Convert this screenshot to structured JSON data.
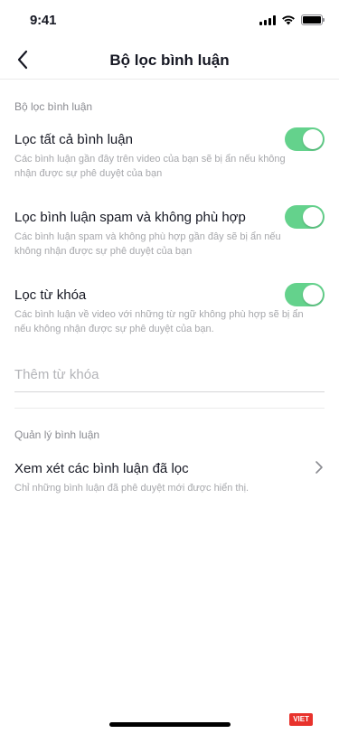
{
  "status_bar": {
    "time": "9:41"
  },
  "header": {
    "title": "Bộ lọc bình luận"
  },
  "section_filter": {
    "title": "Bộ lọc bình luận",
    "items": [
      {
        "label": "Lọc tất cả bình luận",
        "description": "Các bình luận gần đây trên video của bạn sẽ bị ẩn nếu không nhận được sự phê duyệt của bạn",
        "enabled": true
      },
      {
        "label": "Lọc bình luận spam và không phù hợp",
        "description": "Các bình luận spam và không phù hợp gần đây sẽ bị ẩn nếu không nhận được sự phê duyệt của bạn",
        "enabled": true
      },
      {
        "label": "Lọc từ khóa",
        "description": "Các bình luận về video với những từ ngữ không phù hợp sẽ bị ẩn nếu không nhận được sự phê duyệt của bạn.",
        "enabled": true
      }
    ],
    "keyword_input": {
      "placeholder": "Thêm từ khóa",
      "value": ""
    }
  },
  "section_manage": {
    "title": "Quản lý bình luận",
    "review_item": {
      "label": "Xem xét các bình luận đã lọc",
      "description": "Chỉ những bình luận đã phê duyệt mới được hiển thị."
    }
  },
  "watermark": "VIET",
  "colors": {
    "toggle_on": "#64d28c",
    "text_primary": "#161823",
    "text_secondary": "#a6a7ab"
  },
  "icons": [
    "back-arrow-icon",
    "chevron-right-icon",
    "signal-icon",
    "wifi-icon",
    "battery-icon"
  ]
}
